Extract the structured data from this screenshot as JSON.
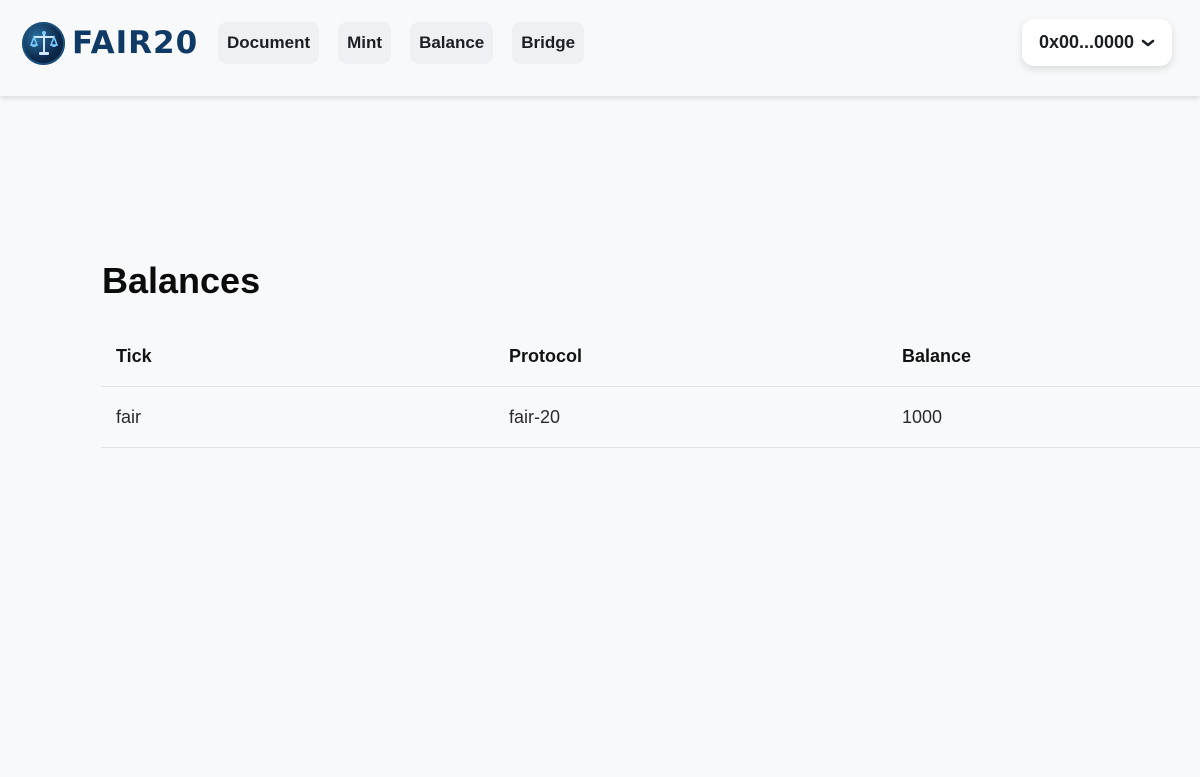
{
  "header": {
    "logo_text": "FAIR20",
    "logo_icon": "scales-of-justice-icon",
    "nav": [
      {
        "label": "Document"
      },
      {
        "label": "Mint"
      },
      {
        "label": "Balance",
        "active": true
      },
      {
        "label": "Bridge"
      }
    ],
    "wallet": {
      "address": "0x00...0000",
      "icon": "chevron-down-icon"
    }
  },
  "main": {
    "title": "Balances",
    "table": {
      "columns": [
        "Tick",
        "Protocol",
        "Balance"
      ],
      "rows": [
        {
          "tick": "fair",
          "protocol": "fair-20",
          "balance": "1000"
        }
      ]
    }
  },
  "colors": {
    "background": "#f8f9fb",
    "logo_text": "#0f3a66",
    "nav_button_bg": "#eef0f3",
    "wallet_bg": "#ffffff",
    "row_divider": "#e3e5e8"
  }
}
